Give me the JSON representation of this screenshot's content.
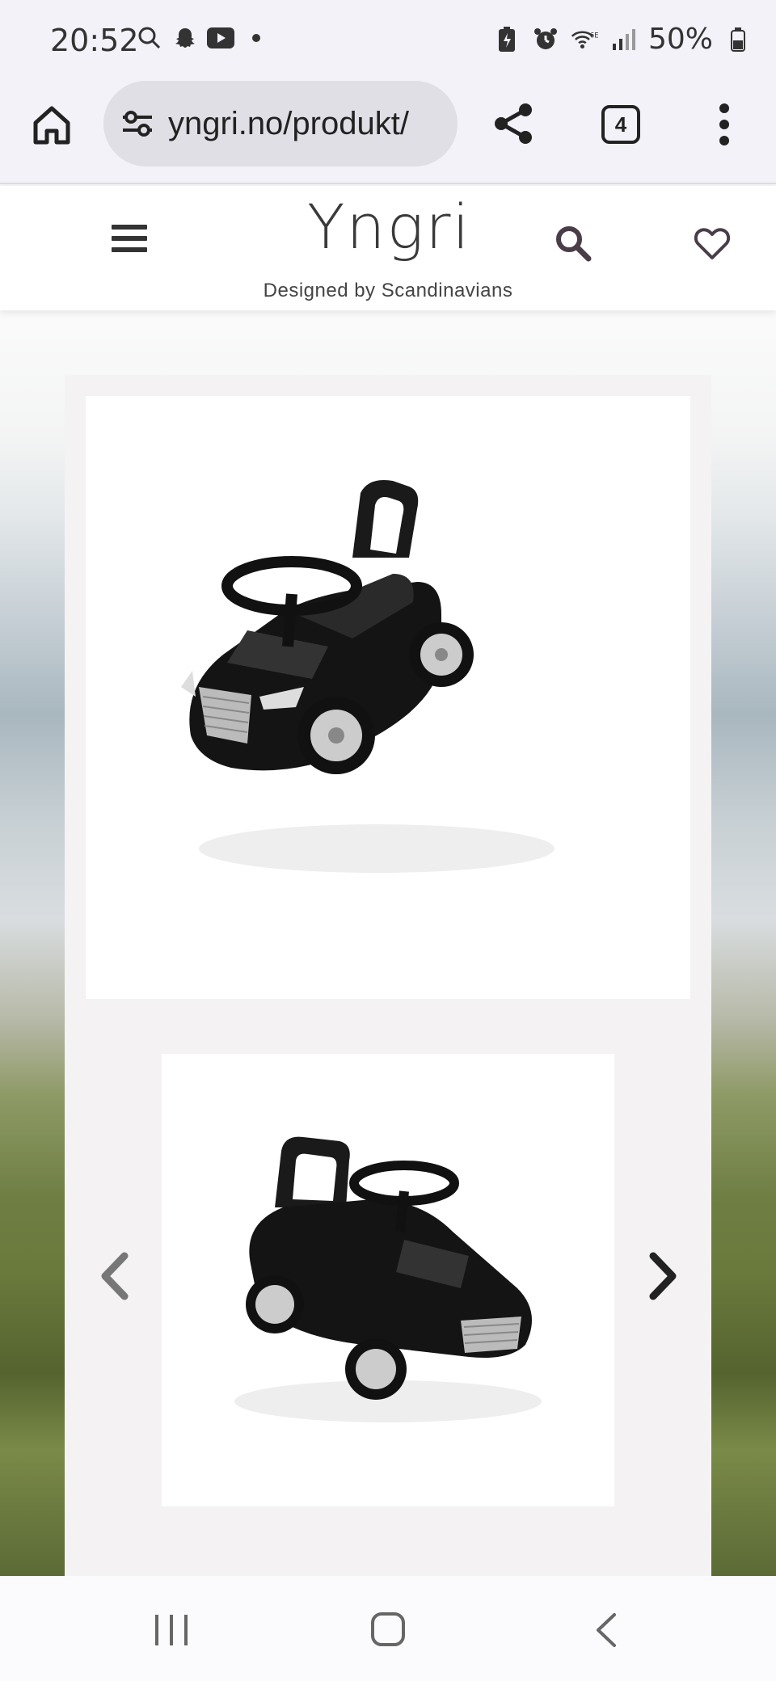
{
  "status_bar": {
    "time": "20:52",
    "battery": "50%",
    "left_icons": [
      "search-icon",
      "snapchat-icon",
      "youtube-icon",
      "dot-icon"
    ],
    "right_icons": [
      "battery-saver-icon",
      "alarm-icon",
      "wifi-6e-icon",
      "signal-icon",
      "battery-icon"
    ]
  },
  "browser": {
    "url": "yngri.no/produkt/",
    "tab_count": "4"
  },
  "site": {
    "logo": "Yngri",
    "tagline": "Designed by Scandinavians"
  },
  "gallery": {
    "main_image": "black ride-on toy car, front three-quarter view",
    "thumb_image": "black ride-on toy car, rear three-quarter view"
  },
  "colors": {
    "accent": "#4a3d47",
    "text": "#333333"
  }
}
